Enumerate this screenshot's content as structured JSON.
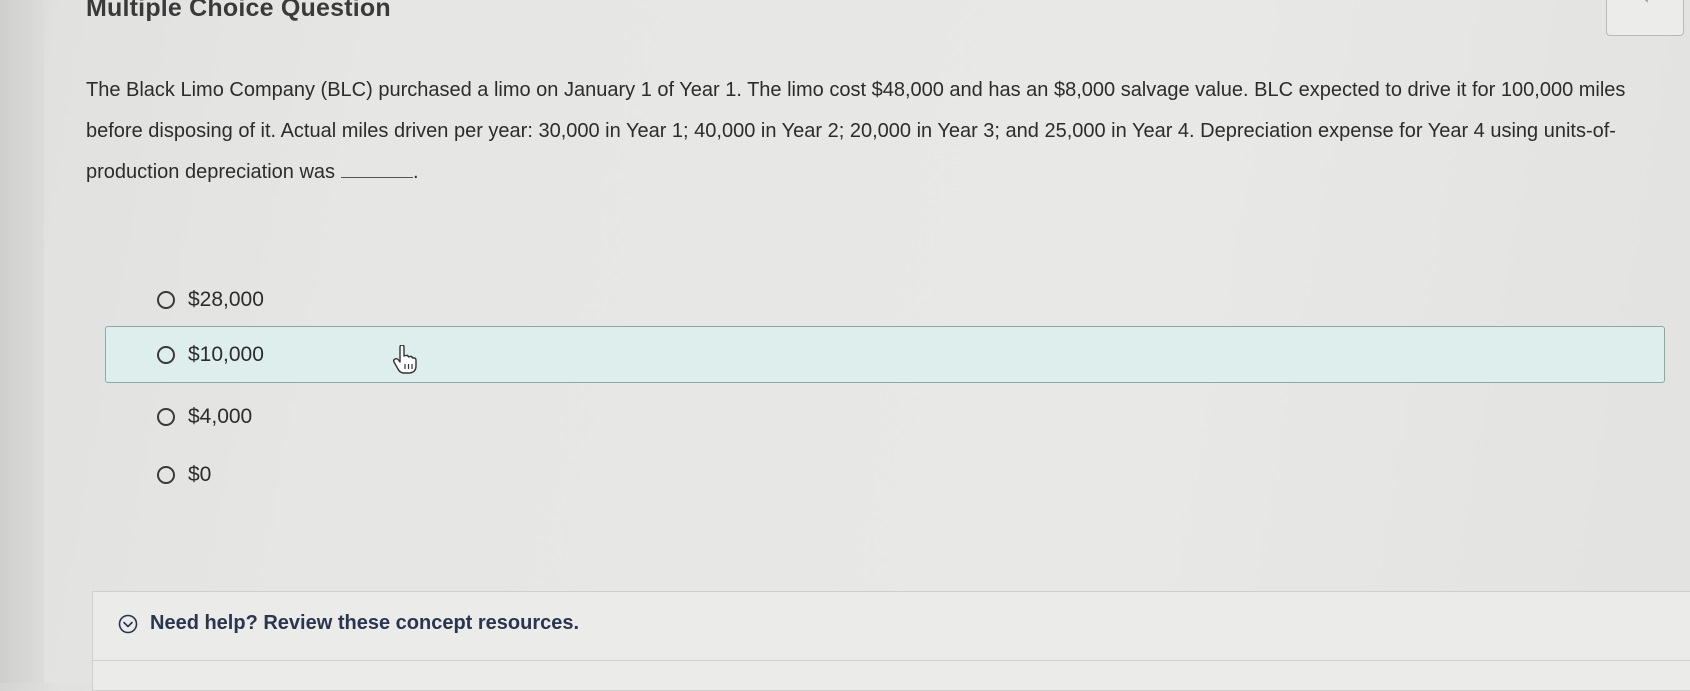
{
  "header": {
    "title": "Multiple Choice Question",
    "audio_icon": "speaker-icon"
  },
  "question": {
    "text": "The Black Limo Company (BLC) purchased a limo on January 1 of Year 1. The limo cost $48,000 and has an $8,000 salvage value. BLC expected to drive it for 100,000 miles before disposing of it. Actual miles driven per year: 30,000 in Year 1; 40,000 in Year 2; 20,000 in Year 3; and 25,000 in Year 4. Depreciation expense for Year 4 using units-of-production depreciation was",
    "end_punctuation": "."
  },
  "choices": [
    {
      "label": "$28,000",
      "hovered": false
    },
    {
      "label": "$10,000",
      "hovered": true
    },
    {
      "label": "$4,000",
      "hovered": false
    },
    {
      "label": "$0",
      "hovered": false
    }
  ],
  "help": {
    "label": "Need help? Review these concept resources.",
    "icon": "chevron-down-circle-icon"
  },
  "colors": {
    "hover_bg": "#ddeeed",
    "hover_border": "#8aa8a8",
    "help_text": "#2a3550"
  }
}
